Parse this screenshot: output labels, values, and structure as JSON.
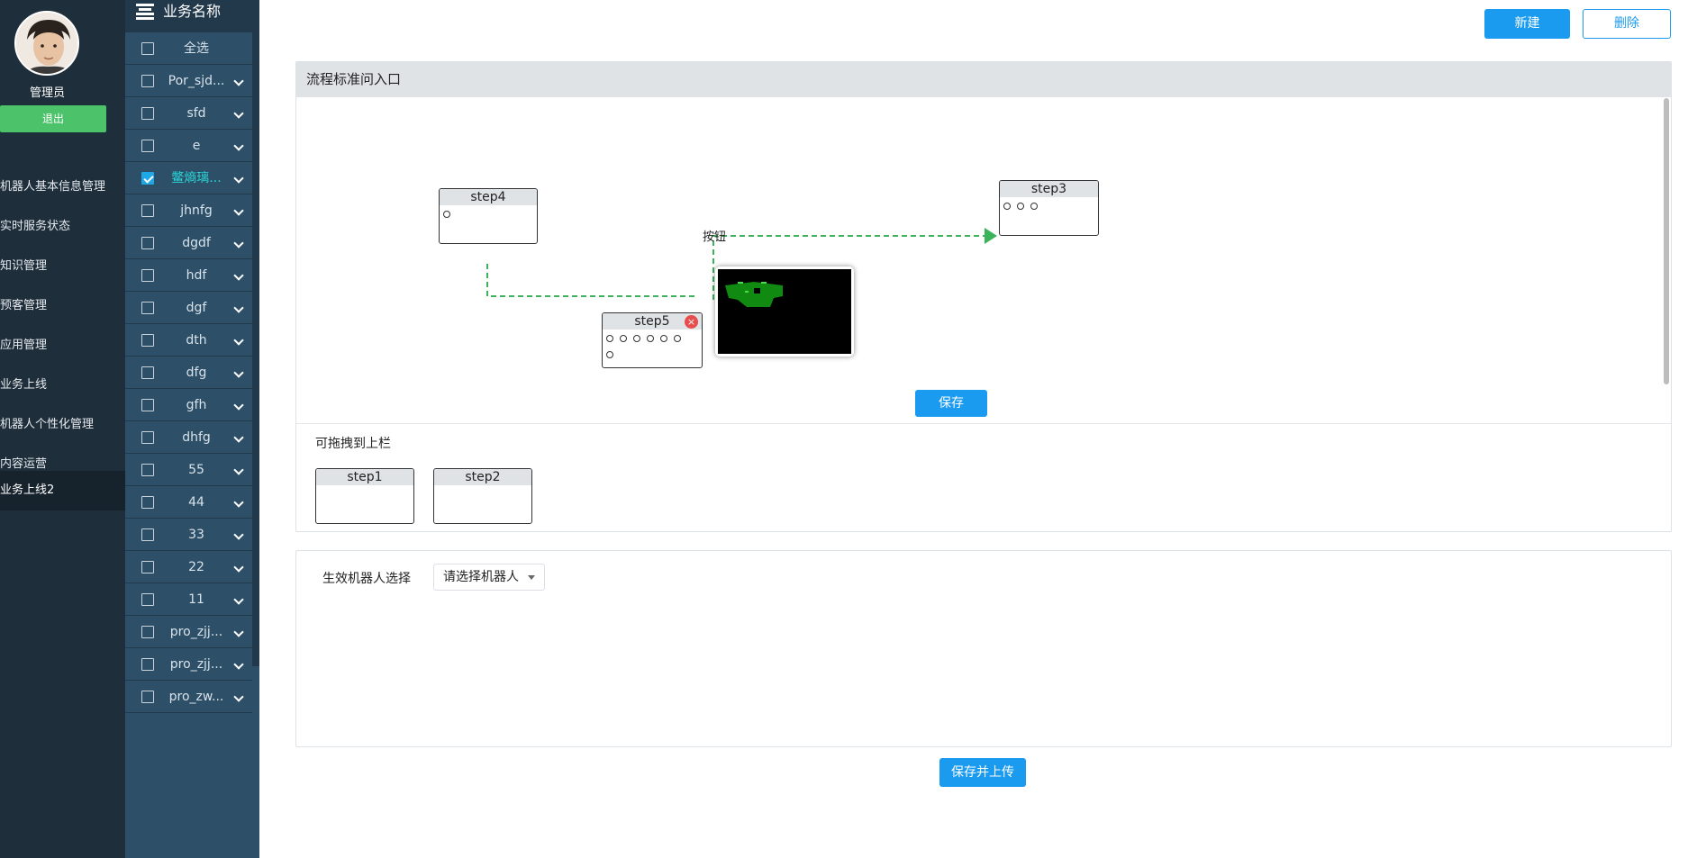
{
  "user": {
    "name": "管理员",
    "logout_label": "退出"
  },
  "nav": {
    "items": [
      {
        "label": "机器人基本信息管理"
      },
      {
        "label": "实时服务状态"
      },
      {
        "label": "知识管理"
      },
      {
        "label": "预客管理"
      },
      {
        "label": "应用管理"
      },
      {
        "label": "业务上线"
      },
      {
        "label": "机器人个性化管理"
      },
      {
        "label": "内容运营"
      },
      {
        "label": "业务上线2",
        "active": true
      }
    ]
  },
  "categories": {
    "title": "业务名称",
    "select_all": "全选",
    "items": [
      {
        "label": "Por_sjd...",
        "checked": false
      },
      {
        "label": "sfd",
        "checked": false
      },
      {
        "label": "e",
        "checked": false
      },
      {
        "label": "鳖熵璃...",
        "checked": true
      },
      {
        "label": "jhnfg",
        "checked": false
      },
      {
        "label": "dgdf",
        "checked": false
      },
      {
        "label": "hdf",
        "checked": false
      },
      {
        "label": "dgf",
        "checked": false
      },
      {
        "label": "dth",
        "checked": false
      },
      {
        "label": "dfg",
        "checked": false
      },
      {
        "label": "gfh",
        "checked": false
      },
      {
        "label": "dhfg",
        "checked": false
      },
      {
        "label": "55",
        "checked": false
      },
      {
        "label": "44",
        "checked": false
      },
      {
        "label": "33",
        "checked": false
      },
      {
        "label": "22",
        "checked": false
      },
      {
        "label": "11",
        "checked": false
      },
      {
        "label": "pro_zjj...",
        "checked": false
      },
      {
        "label": "pro_zjj...",
        "checked": false
      },
      {
        "label": "pro_zw...",
        "checked": false
      }
    ]
  },
  "toolbar": {
    "new_label": "新建",
    "delete_label": "删除"
  },
  "flow": {
    "title": "流程标准问入口",
    "edge_label": "按钮",
    "save_label": "保存",
    "nodes": {
      "step4": "step4",
      "step3": "step3",
      "step5": "step5"
    },
    "palette_label": "可拖拽到上栏",
    "palette": {
      "step1": "step1",
      "step2": "step2"
    }
  },
  "robot": {
    "label": "生效机器人选择",
    "placeholder": "请选择机器人"
  },
  "upload_label": "保存并上传",
  "colors": {
    "primary": "#1a9bf0",
    "nav_bg": "#1e2e3b",
    "category_bg": "#2d4f68",
    "edge": "#3bb35a",
    "logout": "#4cc26a"
  }
}
